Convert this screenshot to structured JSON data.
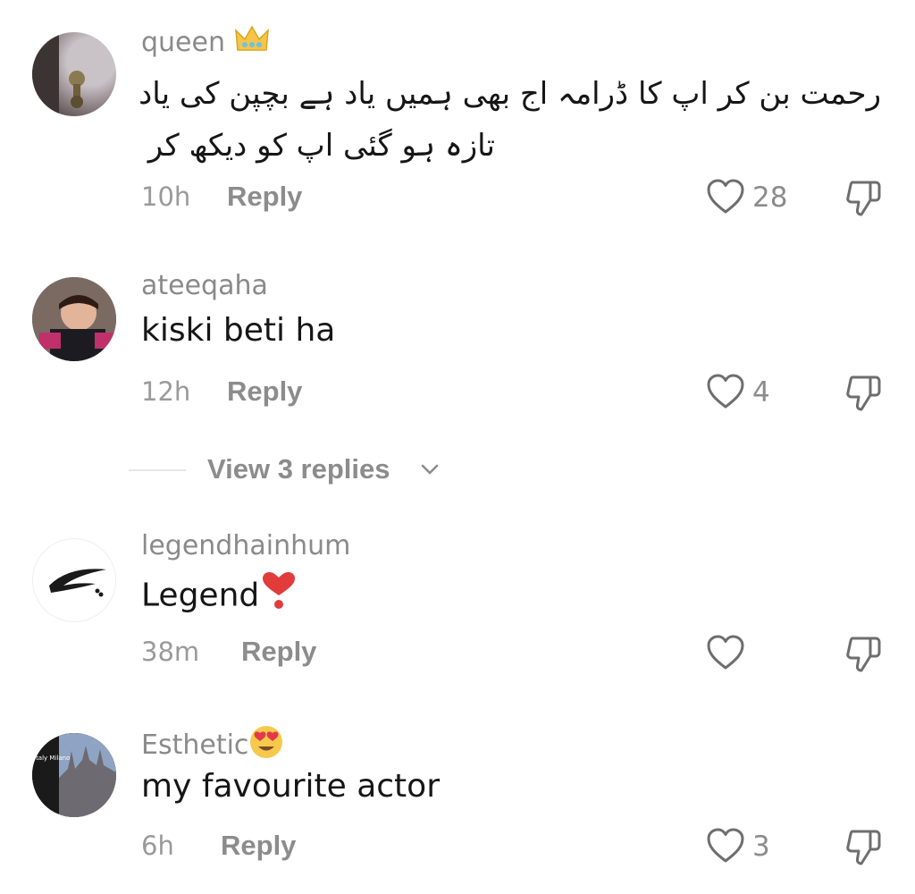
{
  "comments": [
    {
      "username": "queen",
      "username_emoji": "crown-emoji",
      "text_line1": "رحمت بن کر اپ کا ڈرامہ اج بھی ہمیں یاد ہے بچپن کی یاد",
      "text_line2": "تازہ ہو گئی اپ کو دیکھ کر",
      "time": "10h",
      "reply_label": "Reply",
      "likes": "28"
    },
    {
      "username": "ateeqaha",
      "text": "kiski beti ha",
      "time": "12h",
      "reply_label": "Reply",
      "likes": "4"
    },
    {
      "username": "legendhainhum",
      "text": "Legend",
      "text_emoji": "heart-exclamation-emoji",
      "time": "38m",
      "reply_label": "Reply",
      "likes": ""
    },
    {
      "username": "Esthetic",
      "username_emoji": "heart-eyes-emoji",
      "text": "my favourite actor",
      "time": "6h",
      "reply_label": "Reply",
      "likes": "3",
      "avatar_caption": "Italy Milano"
    }
  ],
  "view_replies": {
    "label": "View 3 replies"
  },
  "icons": {
    "like": "heart-outline-icon",
    "dislike": "thumbs-down-icon",
    "chevron": "chevron-down-icon"
  },
  "colors": {
    "username": "#8a8a8a",
    "text": "#161616",
    "meta": "#9a9a9a",
    "icon": "#6e6e6e"
  }
}
